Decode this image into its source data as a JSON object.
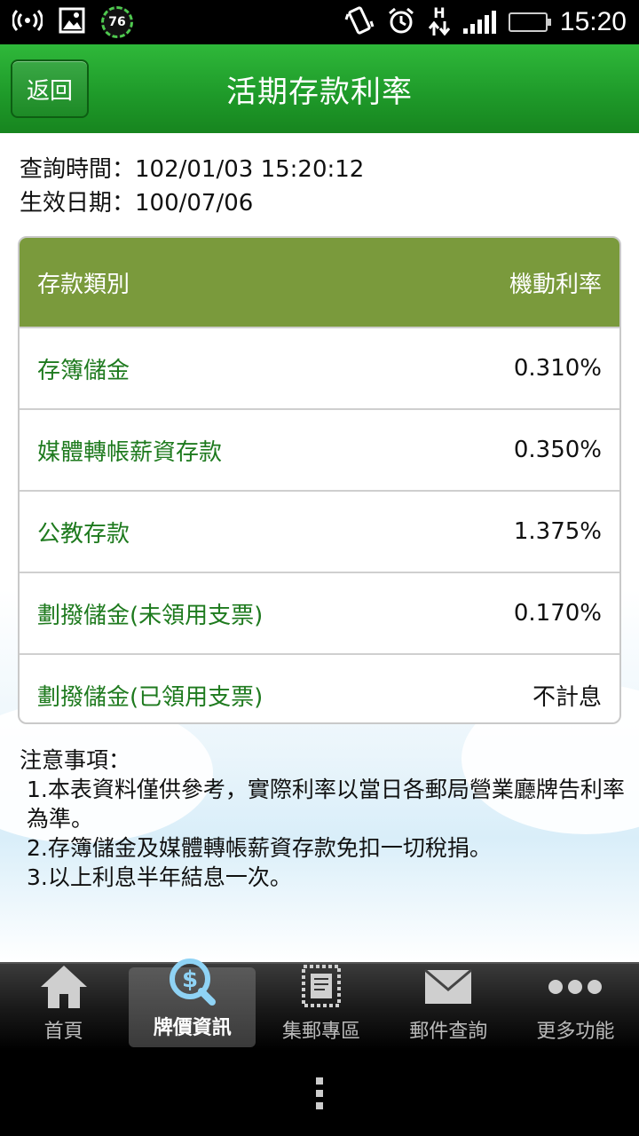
{
  "status_bar": {
    "time": "15:20",
    "badge_value": "76",
    "network_type": "H",
    "icons": [
      "wifi-hotspot-icon",
      "image-icon",
      "badge-icon",
      "vibrate-icon",
      "alarm-icon",
      "data-transfer-icon",
      "signal-icon",
      "battery-icon"
    ]
  },
  "header": {
    "back_label": "返回",
    "title": "活期存款利率"
  },
  "meta": {
    "query_time": "查詢時間：102/01/03 15:20:12",
    "effective_date": "生效日期：100/07/06"
  },
  "table": {
    "header_type": "存款類別",
    "header_rate": "機動利率",
    "rows": [
      {
        "name": "存簿儲金",
        "rate": "0.310%"
      },
      {
        "name": "媒體轉帳薪資存款",
        "rate": "0.350%"
      },
      {
        "name": "公教存款",
        "rate": "1.375%"
      },
      {
        "name": "劃撥儲金(未領用支票)",
        "rate": "0.170%"
      },
      {
        "name": "劃撥儲金(已領用支票)",
        "rate": "不計息"
      }
    ]
  },
  "notes": {
    "title": "注意事項：",
    "items": [
      " 1.本表資料僅供參考，實際利率以當日各郵局營業廳牌告利率為準。",
      " 2.存簿儲金及媒體轉帳薪資存款免扣一切稅捐。",
      " 3.以上利息半年結息一次。"
    ]
  },
  "bottom_nav": {
    "items": [
      {
        "label": "首頁",
        "icon": "home-icon"
      },
      {
        "label": "牌價資訊",
        "icon": "dollar-search-icon"
      },
      {
        "label": "集郵專區",
        "icon": "stamp-icon"
      },
      {
        "label": "郵件查詢",
        "icon": "mail-icon"
      },
      {
        "label": "更多功能",
        "icon": "more-icon"
      }
    ],
    "active_index": 1
  },
  "colors": {
    "header_green": "#1f9b2a",
    "table_header": "#7a9a3c",
    "row_text_green": "#1e7a1e"
  }
}
